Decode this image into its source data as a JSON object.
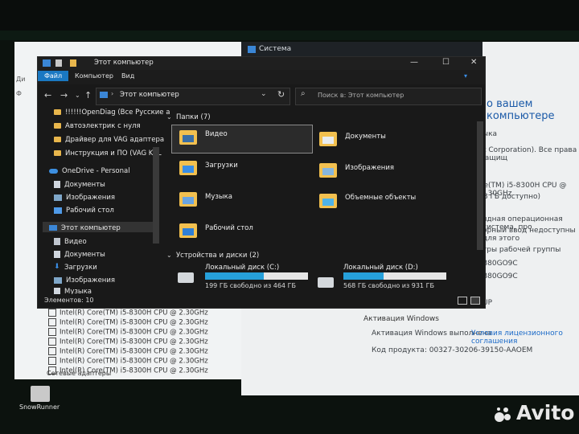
{
  "system_window": {
    "title": "Система",
    "heading": "о вашем компьютере",
    "lines": [
      "ыка",
      "ft Corporation). Все права защищ",
      "re(TM) i5-8300H CPU @ 2.30GHz",
      ",8 ГБ доступно)",
      "ядная операционная система, про",
      "орный ввод недоступны для этого",
      "тры рабочей группы",
      "B80GO9C",
      "B80GO9C",
      "UP"
    ],
    "activation_heading": "Активация Windows",
    "activation_status": "Активация Windows выполнена",
    "license_link": "Условия лицензионного соглашения",
    "product_code": "Код продукта: 00327-30206-39150-AAOEM"
  },
  "left_window": {
    "cpu_rows": [
      "Intel(R) Core(TM) i5-8300H CPU @ 2.30GHz",
      "Intel(R) Core(TM) i5-8300H CPU @ 2.30GHz",
      "Intel(R) Core(TM) i5-8300H CPU @ 2.30GHz",
      "Intel(R) Core(TM) i5-8300H CPU @ 2.30GHz",
      "Intel(R) Core(TM) i5-8300H CPU @ 2.30GHz",
      "Intel(R) Core(TM) i5-8300H CPU @ 2.30GHz",
      "Intel(R) Core(TM) i5-8300H CPU @ 2.30GHz"
    ],
    "net_adapters": "Сетевые адаптеры"
  },
  "desktop": {
    "icon_label": "SnowRunner",
    "watermark": "Avito"
  },
  "explorer": {
    "title": "Этот компьютер",
    "ribbon_tabs": [
      "Файл",
      "Компьютер",
      "Вид"
    ],
    "address": "Этот компьютер",
    "search_placeholder": "Поиск в: Этот компьютер",
    "nav": {
      "quick": [
        "!!!!!!OpenDiag (Все Русские а",
        "Автоэлектрик с нуля",
        "Драйвер для VAG адаптера",
        "Инструкция и ПО (VAG  KKL"
      ],
      "onedrive": "OneDrive - Personal",
      "onedrive_items": [
        "Документы",
        "Изображения",
        "Рабочий стол"
      ],
      "this_pc": "Этот компьютер",
      "pc_items": [
        "Видео",
        "Документы",
        "Загрузки",
        "Изображения",
        "Музыка"
      ]
    },
    "folders_header": "Папки (7)",
    "folders": [
      "Видео",
      "Документы",
      "Загрузки",
      "Изображения",
      "Музыка",
      "Объемные объекты",
      "Рабочий стол"
    ],
    "drives_header": "Устройства и диски (2)",
    "drives": [
      {
        "name": "Локальный диск (C:)",
        "free": "199 ГБ свободно из 464 ГБ",
        "used_fraction": 0.57
      },
      {
        "name": "Локальный диск (D:)",
        "free": "568 ГБ свободно из 931 ГБ",
        "used_fraction": 0.39
      }
    ],
    "status": "Элементов: 10",
    "window_buttons": {
      "minimize": "—",
      "maximize": "☐",
      "close": "✕"
    },
    "colors": {
      "accent": "#1a78c2",
      "folder": "#f2c04f",
      "drive_bar": "#26a0da"
    }
  }
}
